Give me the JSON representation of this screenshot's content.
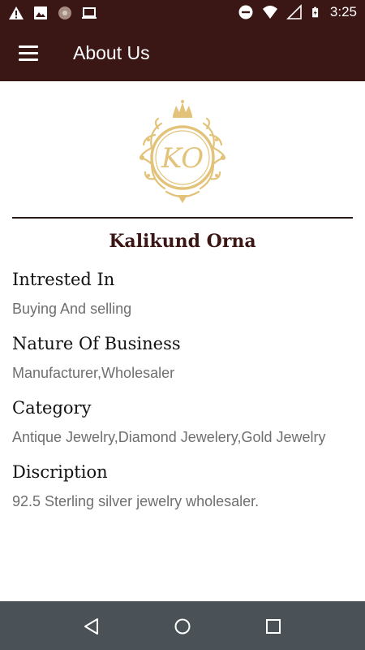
{
  "status_bar": {
    "time": "3:25",
    "left_icons": [
      "warning-icon",
      "image-icon",
      "media-icon",
      "laptop-icon"
    ],
    "right_icons": [
      "do-not-disturb-icon",
      "wifi-icon",
      "signal-icon",
      "battery-charging-icon"
    ]
  },
  "app_bar": {
    "title": "About Us",
    "menu_icon": "hamburger-menu-icon",
    "background_color": "#3a1615"
  },
  "logo": {
    "monogram": "KO",
    "color": "#e3c27a"
  },
  "company": {
    "name": "Kalikund Orna"
  },
  "details": [
    {
      "label": "Intrested In",
      "value": "Buying And selling"
    },
    {
      "label": "Nature Of Business",
      "value": "Manufacturer,Wholesaler"
    },
    {
      "label": "Category",
      "value": "Antique Jewelry,Diamond Jewelery,Gold Jewelry"
    },
    {
      "label": "Discription",
      "value": "92.5 Sterling silver jewelry wholesaler."
    }
  ],
  "nav_bar": {
    "buttons": [
      "back-icon",
      "home-icon",
      "recents-icon"
    ]
  }
}
